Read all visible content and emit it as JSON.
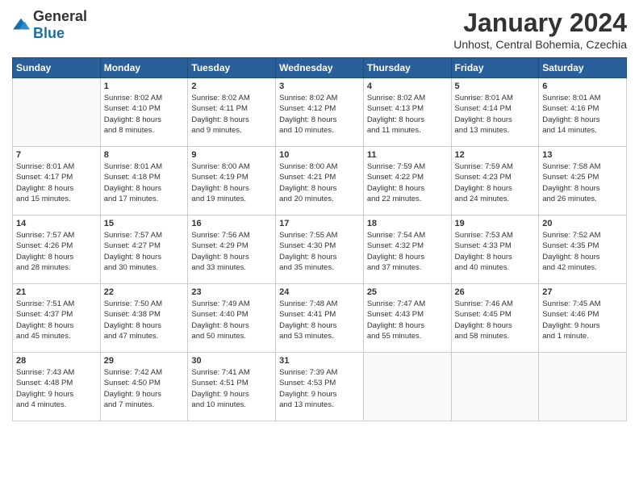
{
  "logo": {
    "general": "General",
    "blue": "Blue"
  },
  "title": "January 2024",
  "subtitle": "Unhost, Central Bohemia, Czechia",
  "days": [
    "Sunday",
    "Monday",
    "Tuesday",
    "Wednesday",
    "Thursday",
    "Friday",
    "Saturday"
  ],
  "weeks": [
    [
      {
        "day": "",
        "content": ""
      },
      {
        "day": "1",
        "content": "Sunrise: 8:02 AM\nSunset: 4:10 PM\nDaylight: 8 hours\nand 8 minutes."
      },
      {
        "day": "2",
        "content": "Sunrise: 8:02 AM\nSunset: 4:11 PM\nDaylight: 8 hours\nand 9 minutes."
      },
      {
        "day": "3",
        "content": "Sunrise: 8:02 AM\nSunset: 4:12 PM\nDaylight: 8 hours\nand 10 minutes."
      },
      {
        "day": "4",
        "content": "Sunrise: 8:02 AM\nSunset: 4:13 PM\nDaylight: 8 hours\nand 11 minutes."
      },
      {
        "day": "5",
        "content": "Sunrise: 8:01 AM\nSunset: 4:14 PM\nDaylight: 8 hours\nand 13 minutes."
      },
      {
        "day": "6",
        "content": "Sunrise: 8:01 AM\nSunset: 4:16 PM\nDaylight: 8 hours\nand 14 minutes."
      }
    ],
    [
      {
        "day": "7",
        "content": "Sunrise: 8:01 AM\nSunset: 4:17 PM\nDaylight: 8 hours\nand 15 minutes."
      },
      {
        "day": "8",
        "content": "Sunrise: 8:01 AM\nSunset: 4:18 PM\nDaylight: 8 hours\nand 17 minutes."
      },
      {
        "day": "9",
        "content": "Sunrise: 8:00 AM\nSunset: 4:19 PM\nDaylight: 8 hours\nand 19 minutes."
      },
      {
        "day": "10",
        "content": "Sunrise: 8:00 AM\nSunset: 4:21 PM\nDaylight: 8 hours\nand 20 minutes."
      },
      {
        "day": "11",
        "content": "Sunrise: 7:59 AM\nSunset: 4:22 PM\nDaylight: 8 hours\nand 22 minutes."
      },
      {
        "day": "12",
        "content": "Sunrise: 7:59 AM\nSunset: 4:23 PM\nDaylight: 8 hours\nand 24 minutes."
      },
      {
        "day": "13",
        "content": "Sunrise: 7:58 AM\nSunset: 4:25 PM\nDaylight: 8 hours\nand 26 minutes."
      }
    ],
    [
      {
        "day": "14",
        "content": "Sunrise: 7:57 AM\nSunset: 4:26 PM\nDaylight: 8 hours\nand 28 minutes."
      },
      {
        "day": "15",
        "content": "Sunrise: 7:57 AM\nSunset: 4:27 PM\nDaylight: 8 hours\nand 30 minutes."
      },
      {
        "day": "16",
        "content": "Sunrise: 7:56 AM\nSunset: 4:29 PM\nDaylight: 8 hours\nand 33 minutes."
      },
      {
        "day": "17",
        "content": "Sunrise: 7:55 AM\nSunset: 4:30 PM\nDaylight: 8 hours\nand 35 minutes."
      },
      {
        "day": "18",
        "content": "Sunrise: 7:54 AM\nSunset: 4:32 PM\nDaylight: 8 hours\nand 37 minutes."
      },
      {
        "day": "19",
        "content": "Sunrise: 7:53 AM\nSunset: 4:33 PM\nDaylight: 8 hours\nand 40 minutes."
      },
      {
        "day": "20",
        "content": "Sunrise: 7:52 AM\nSunset: 4:35 PM\nDaylight: 8 hours\nand 42 minutes."
      }
    ],
    [
      {
        "day": "21",
        "content": "Sunrise: 7:51 AM\nSunset: 4:37 PM\nDaylight: 8 hours\nand 45 minutes."
      },
      {
        "day": "22",
        "content": "Sunrise: 7:50 AM\nSunset: 4:38 PM\nDaylight: 8 hours\nand 47 minutes."
      },
      {
        "day": "23",
        "content": "Sunrise: 7:49 AM\nSunset: 4:40 PM\nDaylight: 8 hours\nand 50 minutes."
      },
      {
        "day": "24",
        "content": "Sunrise: 7:48 AM\nSunset: 4:41 PM\nDaylight: 8 hours\nand 53 minutes."
      },
      {
        "day": "25",
        "content": "Sunrise: 7:47 AM\nSunset: 4:43 PM\nDaylight: 8 hours\nand 55 minutes."
      },
      {
        "day": "26",
        "content": "Sunrise: 7:46 AM\nSunset: 4:45 PM\nDaylight: 8 hours\nand 58 minutes."
      },
      {
        "day": "27",
        "content": "Sunrise: 7:45 AM\nSunset: 4:46 PM\nDaylight: 9 hours\nand 1 minute."
      }
    ],
    [
      {
        "day": "28",
        "content": "Sunrise: 7:43 AM\nSunset: 4:48 PM\nDaylight: 9 hours\nand 4 minutes."
      },
      {
        "day": "29",
        "content": "Sunrise: 7:42 AM\nSunset: 4:50 PM\nDaylight: 9 hours\nand 7 minutes."
      },
      {
        "day": "30",
        "content": "Sunrise: 7:41 AM\nSunset: 4:51 PM\nDaylight: 9 hours\nand 10 minutes."
      },
      {
        "day": "31",
        "content": "Sunrise: 7:39 AM\nSunset: 4:53 PM\nDaylight: 9 hours\nand 13 minutes."
      },
      {
        "day": "",
        "content": ""
      },
      {
        "day": "",
        "content": ""
      },
      {
        "day": "",
        "content": ""
      }
    ]
  ]
}
